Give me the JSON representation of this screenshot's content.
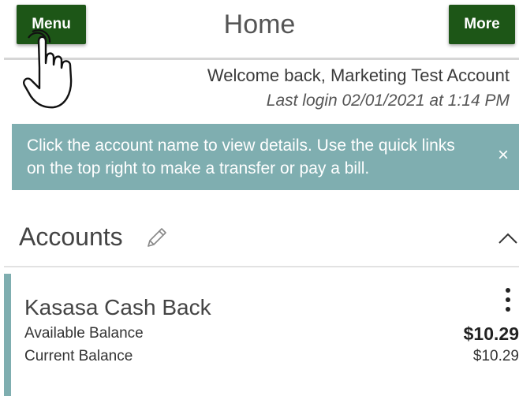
{
  "header": {
    "menu_label": "Menu",
    "title": "Home",
    "more_label": "More"
  },
  "welcome": {
    "greeting": "Welcome back, Marketing Test Account",
    "last_login": "Last login 02/01/2021 at 1:14 PM"
  },
  "notice": {
    "text": "Click the account name to view details. Use the quick links on the top right to make a transfer or pay a bill.",
    "close_glyph": "×"
  },
  "accounts": {
    "heading": "Accounts",
    "items": [
      {
        "name": "Kasasa Cash Back",
        "available_label": "Available Balance",
        "available_value": "$10.29",
        "current_label": "Current Balance",
        "current_value": "$10.29"
      }
    ]
  },
  "icons": {
    "edit": "pencil-icon",
    "collapse": "chevron-up-icon",
    "account_menu": "kebab-menu-icon",
    "pointer": "hand-pointer-icon",
    "close": "close-icon"
  },
  "colors": {
    "primary_button": "#1d5617",
    "notice_bg": "#7faeb0",
    "account_accent": "#7faeb0"
  }
}
